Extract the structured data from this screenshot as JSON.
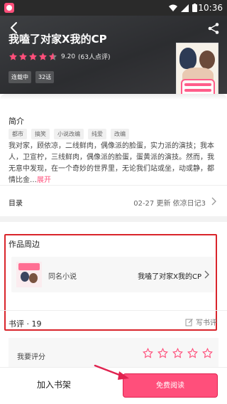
{
  "status_bar": {
    "time": "10:36"
  },
  "book": {
    "title": "我嗑了对家X我的CP",
    "score": "9.20",
    "rating_count": "(63人点评)",
    "tags": [
      "连载中",
      "32话"
    ]
  },
  "intro": {
    "heading": "简介",
    "tags": [
      "都市",
      "搞笑",
      "小说改编",
      "纯爱",
      "改编"
    ],
    "text": "我对家，顾依凉，二线鲜肉，偶像派的脸蛋，实力派的演技；我本人，卫宣柠，三线鲜肉，偶像派的脸蛋，蛋黄派的演技。然而，我无意中发现，在一个奇妙的世界里，无论我们站或坐，动或静，都情比金…",
    "expand_label": "展开"
  },
  "catalog": {
    "label": "目录",
    "info": "02-27  更新  依凉日记3"
  },
  "around": {
    "heading": "作品周边",
    "novel_label": "同名小说",
    "novel_name": "我嗑了对家X我的CP"
  },
  "reviews": {
    "label": "书评 · 19",
    "write_label": "写书评",
    "my_rating_label": "我要评分"
  },
  "bottom_bar": {
    "add_shelf_label": "加入书架",
    "read_label": "免费阅读"
  },
  "colors": {
    "accent": "#ff4f7b",
    "highlight_box": "#d9252b",
    "star": "#ff4f7b"
  }
}
